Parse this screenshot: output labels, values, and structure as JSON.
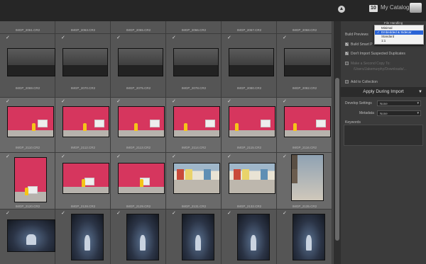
{
  "catalog": {
    "badge": "10",
    "title": "My Catalog"
  },
  "panel": {
    "file_handling_label": "File Handling",
    "render_previews_label": "Build Previews",
    "build_smart_label": "Build Smart P",
    "dont_import_label": "Don't Import Suspected Duplicates",
    "second_copy_label": "Make a Second Copy To:",
    "second_copy_path": "/Users/Jakemurphy/Downloads/...",
    "add_collection_label": "Add to Collection",
    "apply_during_import": "Apply During Import",
    "develop_settings_label": "Develop Settings",
    "develop_settings_value": "None",
    "metadata_label": "Metadata",
    "metadata_value": "None",
    "keywords_label": "Keywords"
  },
  "preview_dropdown": {
    "options": [
      "Minimal",
      "Embedded & Sidecar",
      "Standard",
      "1:1"
    ],
    "selected": "Embedded & Sidecar"
  },
  "grid": {
    "row1_names": [
      "IMGP_2069.CR2",
      "IMGP_2070.CR2",
      "IMGP_2075.CR2",
      "IMGP_2078.CR2",
      "IMGP_2080.CR2",
      "IMGP_2082.CR2"
    ],
    "row2_names": [
      "IMGP_2110.CR2",
      "IMGP_2112.CR2",
      "IMGP_2113.CR2",
      "IMGP_2114.CR2",
      "IMGP_2115.CR2",
      "IMGP_2116.CR2"
    ],
    "row3_names": [
      "IMGP_2120.CR2",
      "IMGP_2128.CR2",
      "IMGP_2129.CR2",
      "IMGP_2131.CR2",
      "IMGP_2132.CR2",
      "IMGP_2135.CR2"
    ],
    "check": "✓"
  }
}
